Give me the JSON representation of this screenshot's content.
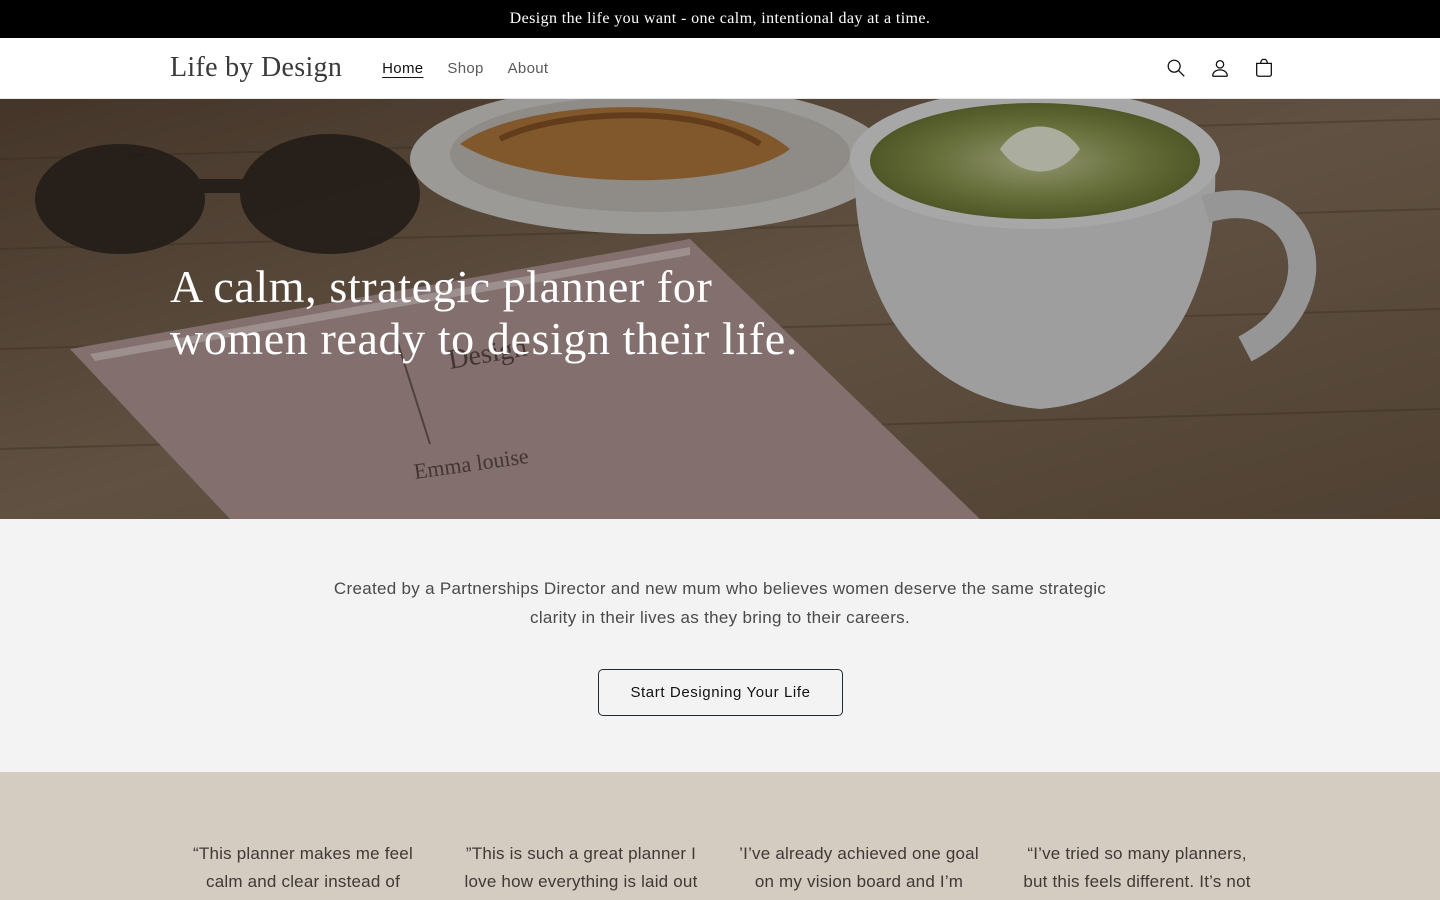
{
  "announcement": {
    "text": "Design the life you want - one calm, intentional day at a time."
  },
  "header": {
    "logo": "Life by Design",
    "nav": [
      {
        "label": "Home",
        "active": true
      },
      {
        "label": "Shop",
        "active": false
      },
      {
        "label": "About",
        "active": false
      }
    ],
    "icons": [
      "search-icon",
      "account-icon",
      "cart-icon"
    ]
  },
  "hero": {
    "title_line1": "A calm, strategic planner for",
    "title_line2": "women ready to design their life.",
    "book_author": "Emma louise",
    "book_title": "Design"
  },
  "intro": {
    "text": "Created by a Partnerships Director and new mum who believes women deserve the same strategic clarity in their lives as they bring to their careers.",
    "cta_label": "Start Designing Your Life"
  },
  "testimonials": [
    {
      "text": "“This planner makes me feel calm and clear instead of"
    },
    {
      "text": "”This is such a great planner I love how everything is laid out"
    },
    {
      "text": "’I’ve already achieved one goal on my vision board and I’m only"
    },
    {
      "text": "“I’ve tried so many planners, but this feels different. It’s not"
    }
  ],
  "colors": {
    "announcement_bg": "#000000",
    "intro_bg": "#f3f3f3",
    "testimonials_bg": "#d4cbc1",
    "cta_border": "#1f2a37"
  }
}
